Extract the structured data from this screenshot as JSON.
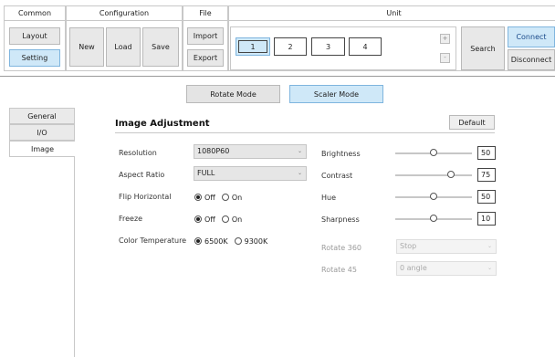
{
  "ribbon": {
    "common": {
      "title": "Common",
      "layout": "Layout",
      "setting": "Setting"
    },
    "configuration": {
      "title": "Configuration",
      "new": "New",
      "load": "Load",
      "save": "Save"
    },
    "file": {
      "title": "File",
      "import": "Import",
      "export": "Export"
    },
    "unit": {
      "title": "Unit",
      "units": [
        "1",
        "2",
        "3",
        "4"
      ],
      "plus": "+",
      "minus": "-",
      "search": "Search",
      "connect": "Connect",
      "disconnect": "Disconnect"
    }
  },
  "modes": {
    "rotate": "Rotate Mode",
    "scaler": "Scaler Mode"
  },
  "nav": {
    "items": [
      "General",
      "I/O",
      "Image"
    ],
    "active": "Image"
  },
  "panel": {
    "title": "Image Adjustment",
    "default_button": "Default",
    "resolution": {
      "label": "Resolution",
      "value": "1080P60"
    },
    "aspect_ratio": {
      "label": "Aspect Ratio",
      "value": "FULL"
    },
    "flip_horizontal": {
      "label": "Flip Horizontal",
      "off": "Off",
      "on": "On",
      "selected": "Off"
    },
    "freeze": {
      "label": "Freeze",
      "off": "Off",
      "on": "On",
      "selected": "Off"
    },
    "color_temperature": {
      "label": "Color Temperature",
      "opt1": "6500K",
      "opt2": "9300K",
      "selected": "6500K"
    },
    "brightness": {
      "label": "Brightness",
      "value": "50",
      "level": 0.5
    },
    "contrast": {
      "label": "Contrast",
      "value": "75",
      "level": 0.75
    },
    "hue": {
      "label": "Hue",
      "value": "50",
      "level": 0.5
    },
    "sharpness": {
      "label": "Sharpness",
      "value": "10",
      "level": 0.5
    },
    "rotate360": {
      "label": "Rotate 360",
      "value": "Stop"
    },
    "rotate45": {
      "label": "Rotate 45",
      "value": "0 angle"
    }
  },
  "colors": {
    "selected_fill": "#cfe8f8",
    "selected_border": "#7fb5de",
    "button_fill": "#e8e8e8"
  },
  "icons": {
    "combo_arrow": "chevron-down-icon"
  }
}
